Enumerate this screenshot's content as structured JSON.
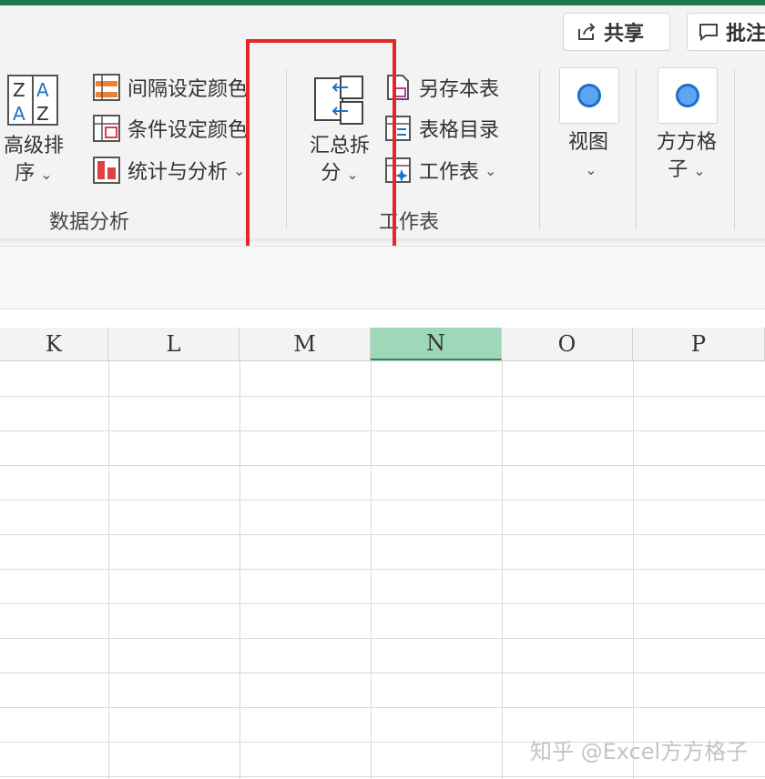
{
  "toolbar": {
    "share_label": "共享",
    "comment_label": "批注"
  },
  "ribbon": {
    "sort_label_line1": "高级排",
    "sort_label_line2": "序",
    "interval_color_label": "间隔设定颜色",
    "condition_color_label": "条件设定颜色",
    "stats_label": "统计与分析",
    "data_analysis_group": "数据分析",
    "summary_split_line1": "汇总拆",
    "summary_split_line2": "分",
    "save_table_label": "另存本表",
    "table_catalog_label": "表格目录",
    "worksheet_label": "工作表",
    "worksheet_group": "工作表",
    "view_label": "视图",
    "ffgz_line1": "方方格",
    "ffgz_line2": "子",
    "chevron": "⌄"
  },
  "sheet": {
    "columns": [
      "K",
      "L",
      "M",
      "N",
      "O",
      "P"
    ],
    "selected_column": "N"
  },
  "watermark": "知乎 @Excel方方格子",
  "colors": {
    "highlight_border": "#e8242b",
    "selected_column": "#9fd8b8",
    "accent_green": "#1f7a4a"
  }
}
